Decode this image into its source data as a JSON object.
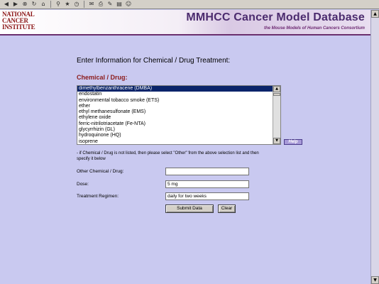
{
  "toolbar": {
    "icons": [
      "back-icon",
      "forward-icon",
      "stop-icon",
      "refresh-icon",
      "home-icon",
      "search-icon",
      "favorites-icon",
      "history-icon",
      "mail-icon",
      "print-icon",
      "edit-icon",
      "discuss-icon",
      "messenger-icon"
    ]
  },
  "banner": {
    "nci_line1": "NATIONAL",
    "nci_line2": "CANCER",
    "nci_line3": "INSTITUTE",
    "title": "MMHCC Cancer Model Database",
    "subtitle": "the Mouse Models of Human Cancers Consortium"
  },
  "form": {
    "heading": "Enter Information for Chemical / Drug Treatment:",
    "chem_label": "Chemical / Drug:",
    "options": [
      "dimethylbenzanthracene (DMBA)",
      "endostatin",
      "environmental tobacco smoke (ETS)",
      "ether",
      "ethyl methanesulfonate (EMS)",
      "ethylene oxide",
      "ferric-nitrilotriacetate (Fe-NTA)",
      "glycyrrhizin (GL)",
      "hydroquinone (HQ)",
      "isoprene"
    ],
    "selected_index": 0,
    "help_label": "Help",
    "note": "- if Chemical / Drug is not listed, then please select \"Other\" from the above selection list and then specify it below",
    "other_label": "Other Chemical / Drug:",
    "other_value": "",
    "dose_label": "Dose:",
    "dose_value": "5 mg",
    "regimen_label": "Treatment Regimen:",
    "regimen_value": "daily for two weeks",
    "submit_label": "Submit Data",
    "clear_label": "Clear"
  }
}
